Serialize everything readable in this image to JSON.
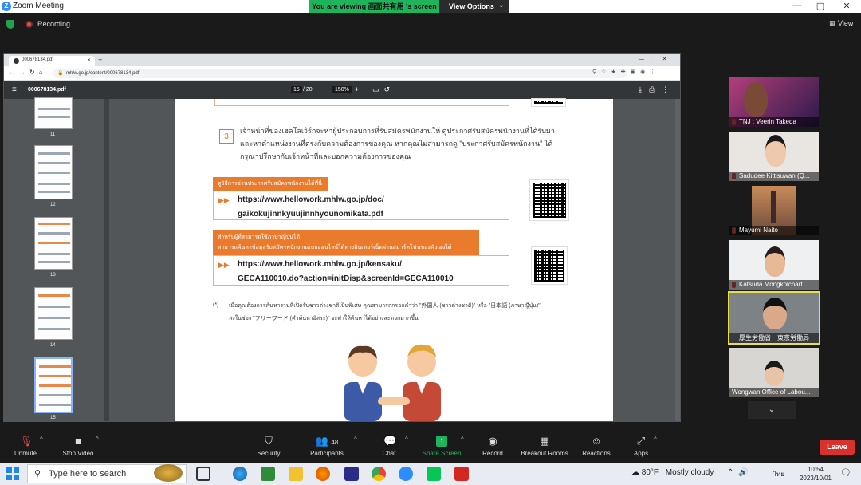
{
  "window": {
    "title": "Zoom Meeting",
    "controls": {
      "minimize": "—",
      "maximize": "▢",
      "close": "✕"
    }
  },
  "banner": {
    "viewing": "You are viewing 画面共有用 's screen",
    "options": "View Options",
    "chevron": "⌄"
  },
  "status": {
    "recording": "Recording",
    "view": "View"
  },
  "browser": {
    "tab_title": "000678134.pdf",
    "new_tab": "+",
    "url": "mhlw.go.jp/content/000678134.pdf",
    "pdf_name": "000678134.pdf",
    "page_current": "15",
    "page_sep": "/",
    "page_total": "20",
    "zoom": "150%",
    "minus": "—",
    "plus": "+"
  },
  "thumbnails": [
    "11",
    "12",
    "13",
    "14",
    "15"
  ],
  "doc": {
    "step_number": "3",
    "step_text_1": "เจ้าหน้าที่ของเฮลโลเวิร์กจะหาผู้ประกอบการที่รับสมัครพนักงานให้ ดูประกาศรับสมัครพนักงานที่ได้รับมา",
    "step_text_2": "และหาตำแหน่งงานที่ตรงกับความต้องการของคุณ หากคุณไม่สามารถดู \"ประกาศรับสมัครพนักงาน\" ได้",
    "step_text_3": "กรุณาปรึกษากับเจ้าหน้าที่และบอกความต้องการของคุณ",
    "box1_title": "ดูวิธีการอ่านประกาศรับสมัครพนักงานได้ที่นี่",
    "box1_url_1": "https://www.hellowork.mhlw.go.jp/doc/",
    "box1_url_2": "gaikokujinnkyuujinnhyounomikata.pdf",
    "box2_title_1": "สำหรับผู้ที่สามารถใช้ภาษาญี่ปุ่นได้",
    "box2_title_2": "สามารถค้นหาข้อมูลรับสมัครพนักงานแบบออนไลน์ได้ทางอินเทอร์เน็ตผ่านสมาร์ทโฟนของตัวเองได้",
    "box2_url_1": "https://www.hellowork.mhlw.go.jp/kensaku/",
    "box2_url_2": "GECA110010.do?action=initDisp&screenId=GECA110010",
    "arrows": "▶▶",
    "note_mark": "(*)",
    "note_1": "เมื่อคุณต้องการค้นหางานที่เปิดรับชาวต่างชาติเป็นพิเศษ คุณสามารถกรอกคำว่า \"外国人 (ชาวต่างชาติ)\" หรือ \"日本語 (ภาษาญี่ปุ่น)\"",
    "note_2": "ลงในช่อง \"フリーワード (คำค้นหาอิสระ)\" จะทำให้ค้นหาได้อย่างสะดวกมากขึ้น"
  },
  "participants": [
    {
      "name": "TNJ : Veerin Takeda"
    },
    {
      "name": "Sadudee Kittisuwan (Q..."
    },
    {
      "name": "Mayumi Naito"
    },
    {
      "name": "Katsuda Mongkolchart"
    },
    {
      "name": "厚生労働省　東京労働局"
    },
    {
      "name": "Wongwan Office of Labou..."
    }
  ],
  "toolbar": {
    "unmute": "Unmute",
    "stop_video": "Stop Video",
    "security": "Security",
    "participants": "Participants",
    "participant_count": "48",
    "chat": "Chat",
    "share_screen": "Share Screen",
    "record": "Record",
    "breakout": "Breakout Rooms",
    "reactions": "Reactions",
    "apps": "Apps",
    "leave": "Leave",
    "caret": "^"
  },
  "taskbar": {
    "search_placeholder": "Type here to search",
    "weather_temp": "80°F",
    "weather_text": "Mostly cloudy",
    "lang": "ไทย",
    "time": "10:54",
    "date": "2023/10/01"
  },
  "colors": {
    "zoom_blue": "#2d8cff",
    "share_green": "#1fb35b",
    "leave_red": "#d9312b",
    "doc_orange": "#ea7b2c",
    "active_border": "#e8e04a"
  }
}
